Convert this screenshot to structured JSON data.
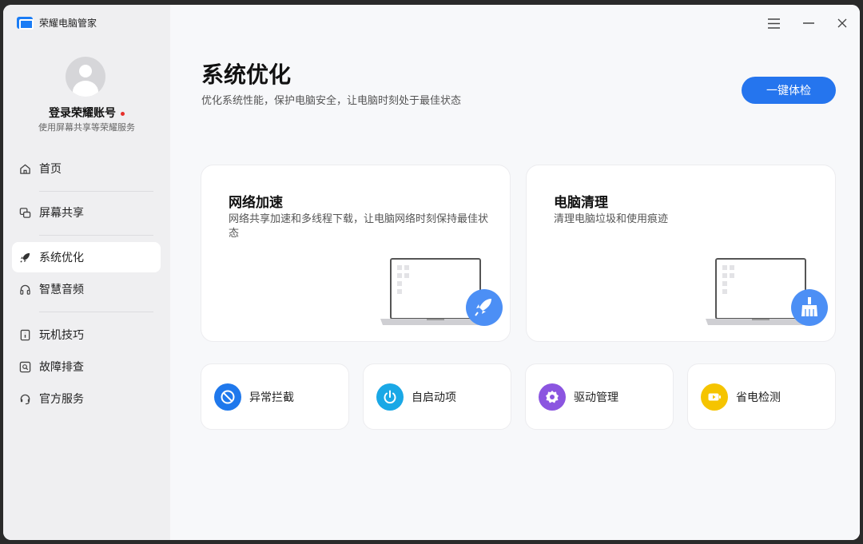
{
  "app": {
    "title": "荣耀电脑管家"
  },
  "account": {
    "name": "登录荣耀账号",
    "subtitle": "使用屏幕共享等荣耀服务"
  },
  "nav": [
    {
      "label": "首页",
      "icon": "home-icon"
    },
    {
      "label": "屏幕共享",
      "icon": "screen-share-icon"
    },
    {
      "label": "系统优化",
      "icon": "rocket-icon",
      "active": true
    },
    {
      "label": "智慧音频",
      "icon": "headphones-icon"
    },
    {
      "label": "玩机技巧",
      "icon": "tips-icon"
    },
    {
      "label": "故障排查",
      "icon": "troubleshoot-icon"
    },
    {
      "label": "官方服务",
      "icon": "headset-icon"
    }
  ],
  "page": {
    "title": "系统优化",
    "subtitle": "优化系统性能，保护电脑安全，让电脑时刻处于最佳状态",
    "check_button": "一键体检"
  },
  "feature_cards": [
    {
      "title": "网络加速",
      "description": "网络共享加速和多线程下载，让电脑网络时刻保持最佳状态",
      "icon": "rocket-icon"
    },
    {
      "title": "电脑清理",
      "description": "清理电脑垃圾和使用痕迹",
      "icon": "broom-icon"
    }
  ],
  "tools": [
    {
      "label": "异常拦截",
      "icon": "block-icon",
      "color": "#1f78ec"
    },
    {
      "label": "自启动项",
      "icon": "power-icon",
      "color": "#1aa8e6"
    },
    {
      "label": "驱动管理",
      "icon": "gear-icon",
      "color": "#8b55e0"
    },
    {
      "label": "省电检测",
      "icon": "battery-icon",
      "color": "#f5c400"
    }
  ],
  "colors": {
    "accent": "#2575ee",
    "sidebar_bg": "#efeff1",
    "notification_dot": "#e6302b"
  }
}
